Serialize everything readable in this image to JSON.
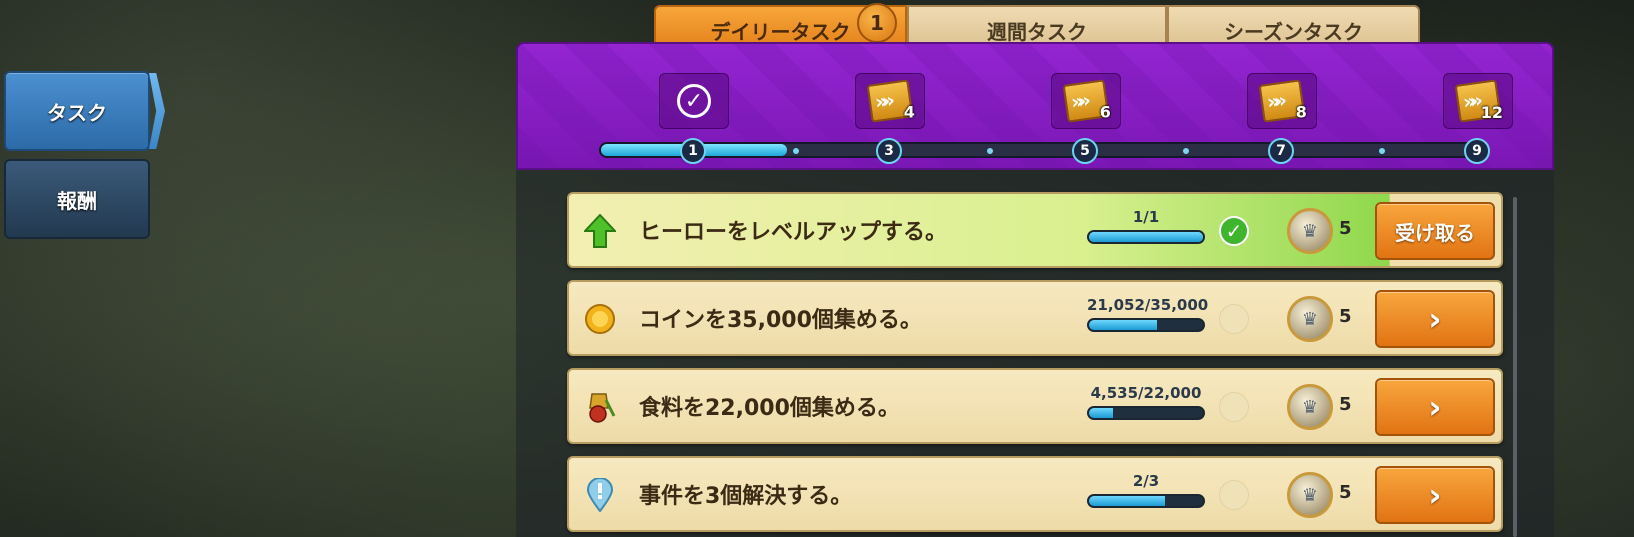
{
  "side_nav": {
    "tasks": "タスク",
    "rewards": "報酬"
  },
  "tabs": {
    "daily": "デイリータスク",
    "daily_badge": "1",
    "weekly": "週間タスク",
    "season": "シーズンタスク"
  },
  "milestones": [
    {
      "node": "1",
      "reward": "check-icon",
      "count": ""
    },
    {
      "node": "3",
      "reward": "ticket-icon",
      "count": "4"
    },
    {
      "node": "5",
      "reward": "ticket-icon",
      "count": "6"
    },
    {
      "node": "7",
      "reward": "ticket-icon",
      "count": "8"
    },
    {
      "node": "9",
      "reward": "ticket-icon",
      "count": "12"
    }
  ],
  "milestone_progress": 0.21,
  "tasks": [
    {
      "label": "ヒーローをレベルアップする。",
      "progress": "1/1",
      "fraction": 1.0,
      "reward": "5",
      "button": "受け取る",
      "done": true,
      "icon": "level-up-arrow-icon"
    },
    {
      "label": "コインを35,000個集める。",
      "progress": "21,052/35,000",
      "fraction": 0.6,
      "reward": "5",
      "button": "›",
      "done": false,
      "icon": "coin-icon"
    },
    {
      "label": "食料を22,000個集める。",
      "progress": "4,535/22,000",
      "fraction": 0.21,
      "reward": "5",
      "button": "›",
      "done": false,
      "icon": "food-icon"
    },
    {
      "label": "事件を3個解決する。",
      "progress": "2/3",
      "fraction": 0.67,
      "reward": "5",
      "button": "›",
      "done": false,
      "icon": "event-marker-icon"
    }
  ],
  "colors": {
    "accent_orange": "#e07d15",
    "header_purple": "#8a1ec6",
    "progress_blue": "#1fa6d8"
  }
}
